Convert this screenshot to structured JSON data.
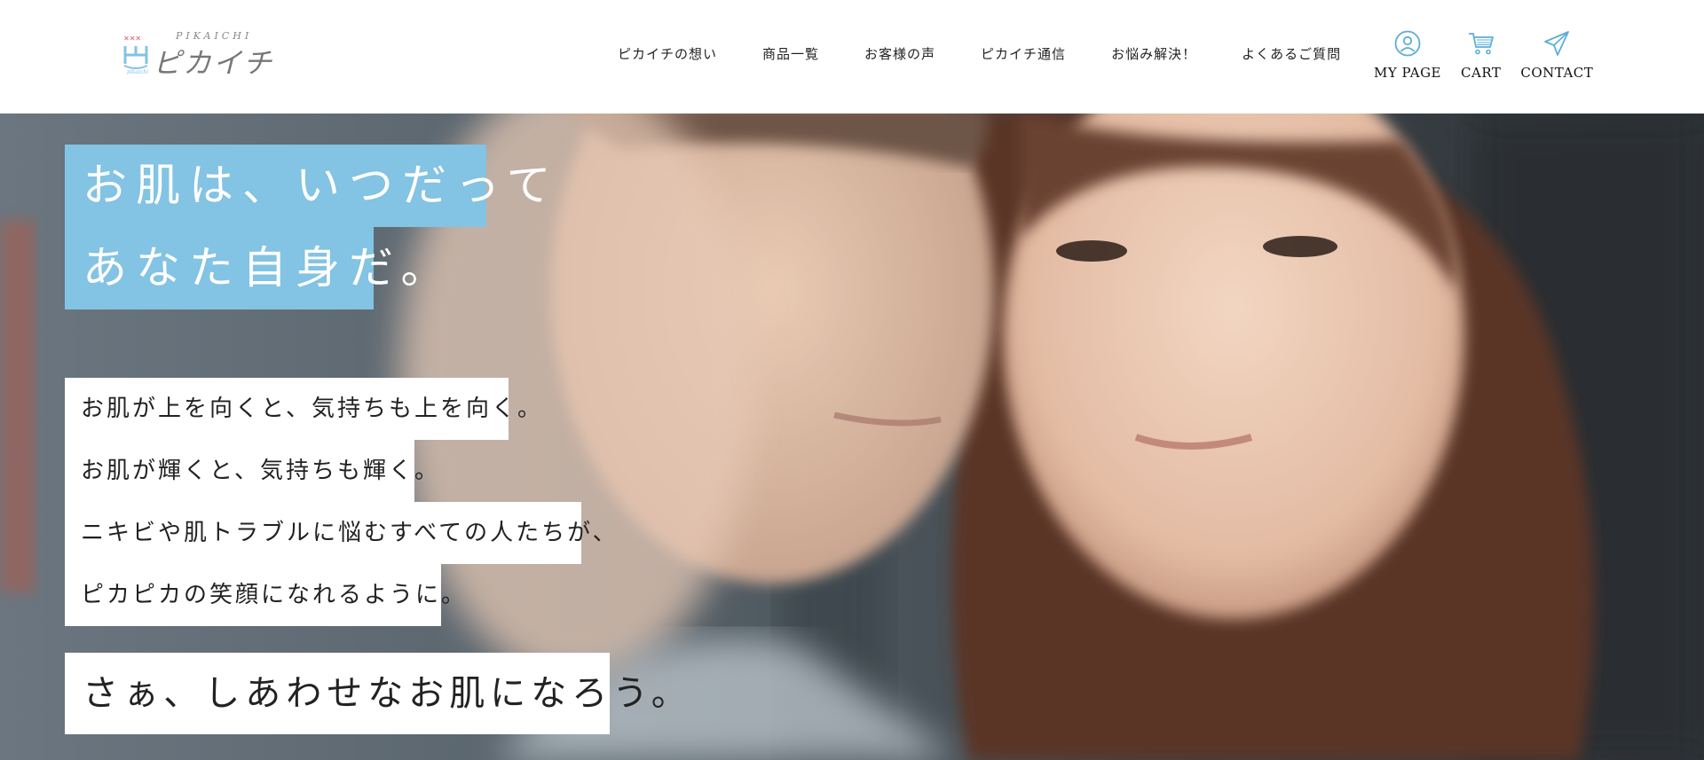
{
  "brand": {
    "romaji": "PIKAICHI",
    "name": "ピカイチ",
    "accent_color": "#83c3e3"
  },
  "nav": {
    "items": [
      {
        "label": "ピカイチの想い"
      },
      {
        "label": "商品一覧"
      },
      {
        "label": "お客様の声"
      },
      {
        "label": "ピカイチ通信"
      },
      {
        "label": "お悩み解決！"
      },
      {
        "label": "よくあるご質問"
      }
    ]
  },
  "icon_links": {
    "mypage": {
      "label": "MY PAGE",
      "icon": "user-circle-icon"
    },
    "cart": {
      "label": "CART",
      "icon": "cart-icon"
    },
    "contact": {
      "label": "CONTACT",
      "icon": "paper-plane-icon"
    }
  },
  "hero": {
    "headline": [
      "お肌は、いつだって",
      "あなた自身だ。"
    ],
    "body_lines": [
      "お肌が上を向くと、気持ちも上を向く。",
      "お肌が輝くと、気持ちも輝く。",
      "ニキビや肌トラブルに悩むすべての人たちが、",
      "ピカピカの笑顔になれるように。"
    ],
    "closing": "さぁ、しあわせなお肌になろう。"
  }
}
